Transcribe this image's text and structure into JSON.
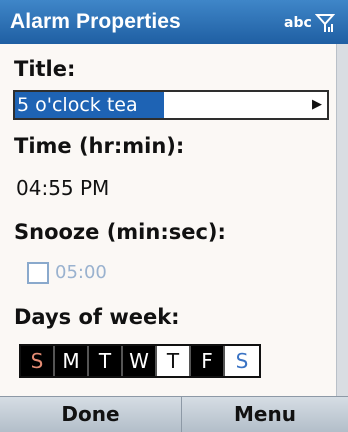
{
  "titlebar": {
    "title": "Alarm Properties",
    "input_mode": "abc",
    "signal_icon": "signal-strength-icon"
  },
  "form": {
    "title_label": "Title:",
    "title_value": "5 o'clock tea",
    "time_label": "Time (hr:min):",
    "time_value": "04:55 PM",
    "snooze_label": "Snooze (min:sec):",
    "snooze_checked": false,
    "snooze_value": "05:00",
    "days_label": "Days of week:",
    "days": [
      {
        "label": "S",
        "selected": true
      },
      {
        "label": "M",
        "selected": true
      },
      {
        "label": "T",
        "selected": true
      },
      {
        "label": "W",
        "selected": true
      },
      {
        "label": "T",
        "selected": false
      },
      {
        "label": "F",
        "selected": true
      },
      {
        "label": "S",
        "selected": false
      }
    ]
  },
  "softkeys": {
    "left": "Done",
    "right": "Menu"
  },
  "colors": {
    "titlebar": "#1f5fa3",
    "selection": "#1e63b4",
    "sunday_text": "#e48b73",
    "saturday_text": "#3a73c4"
  }
}
